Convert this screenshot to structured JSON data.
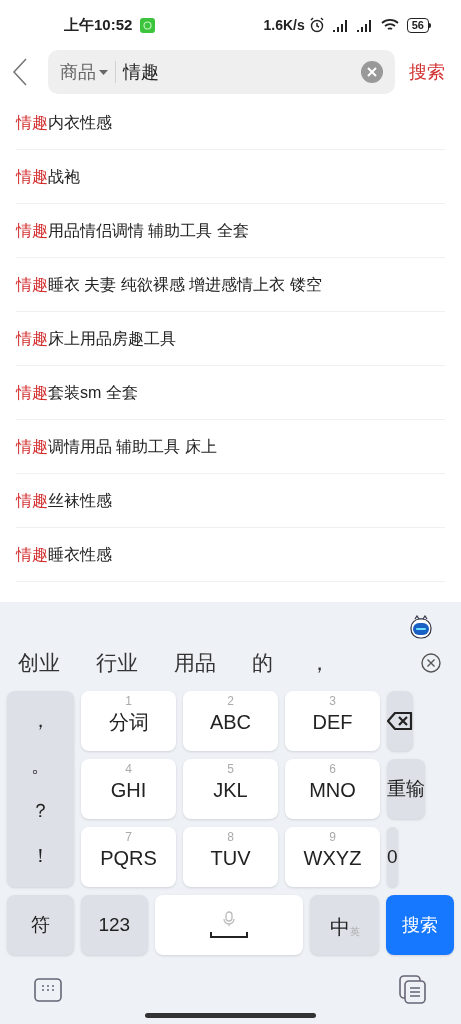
{
  "status_bar": {
    "time": "上午10:52",
    "speed": "1.6K/s",
    "battery": "56"
  },
  "search": {
    "scope": "商品",
    "value": "情趣",
    "button": "搜索"
  },
  "suggestions": [
    {
      "highlight": "情趣",
      "rest": "内衣性感"
    },
    {
      "highlight": "情趣",
      "rest": "战袍"
    },
    {
      "highlight": "情趣",
      "rest": "用品情侣调情 辅助工具 全套"
    },
    {
      "highlight": "情趣",
      "rest": "睡衣 夫妻 纯欲裸感 增进感情上衣 镂空"
    },
    {
      "highlight": "情趣",
      "rest": "床上用品房趣工具"
    },
    {
      "highlight": "情趣",
      "rest": "套装sm 全套"
    },
    {
      "highlight": "情趣",
      "rest": "调情用品 辅助工具 床上"
    },
    {
      "highlight": "情趣",
      "rest": "丝袜性感"
    },
    {
      "highlight": "情趣",
      "rest": "睡衣性感"
    }
  ],
  "candidates": [
    "创业",
    "行业",
    "用品",
    "的",
    "，"
  ],
  "symbols": [
    "，",
    "。",
    "？",
    "！"
  ],
  "keys": [
    {
      "digit": "1",
      "label": "分词"
    },
    {
      "digit": "2",
      "label": "ABC"
    },
    {
      "digit": "3",
      "label": "DEF"
    },
    {
      "digit": "4",
      "label": "GHI"
    },
    {
      "digit": "5",
      "label": "JKL"
    },
    {
      "digit": "6",
      "label": "MNO"
    },
    {
      "digit": "7",
      "label": "PQRS"
    },
    {
      "digit": "8",
      "label": "TUV"
    },
    {
      "digit": "9",
      "label": "WXYZ"
    }
  ],
  "side_keys": [
    {
      "kind": "backspace"
    },
    {
      "kind": "text",
      "label": "重输"
    },
    {
      "kind": "text",
      "label": "0"
    }
  ],
  "bottom_keys": [
    {
      "kind": "key",
      "label": "符"
    },
    {
      "kind": "key",
      "label": "123"
    },
    {
      "kind": "space"
    },
    {
      "kind": "lang",
      "label": "中",
      "sub": "英"
    },
    {
      "kind": "action",
      "label": "搜索"
    }
  ]
}
